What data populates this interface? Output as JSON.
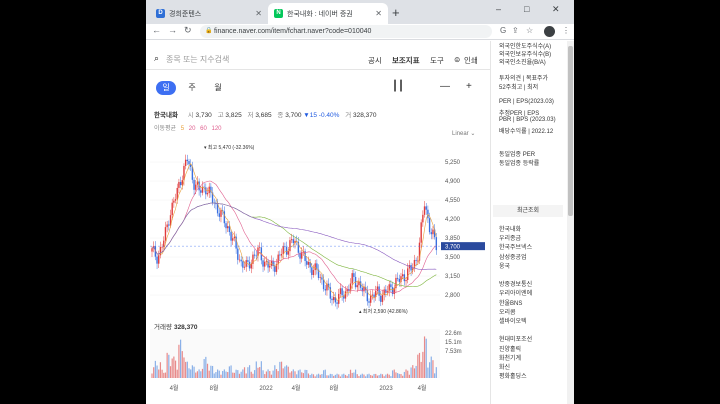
{
  "browser": {
    "tabs": [
      {
        "title": "경희준텐스",
        "favicon": "D",
        "favicon_color": "#2f6fd6"
      },
      {
        "title": "한국내화 : 네이버 증권",
        "favicon": "N",
        "favicon_color": "#03c75a"
      }
    ],
    "new_tab": "+",
    "url": "finance.naver.com/item/fchart.naver?code=010040",
    "window_controls": [
      "–",
      "□",
      "✕"
    ]
  },
  "header": {
    "search_placeholder": "종목 또는 지수검색",
    "menu": [
      "공시",
      "보조지표",
      "도구",
      "인쇄"
    ]
  },
  "periods": [
    {
      "label": "일",
      "active": true
    },
    {
      "label": "주",
      "active": false
    },
    {
      "label": "월",
      "active": false
    }
  ],
  "quote": {
    "name": "한국내화",
    "open_label": "시",
    "open": "3,730",
    "high_label": "고",
    "high": "3,825",
    "low_label": "저",
    "low": "3,685",
    "close_label": "종",
    "close": "3,700",
    "change": "▼15",
    "change_pct": "-0.40%",
    "volume_label": "거",
    "volume": "328,370"
  },
  "ma": {
    "label": "이동평균",
    "values": [
      {
        "text": "5",
        "color": "#e8a03a"
      },
      {
        "text": "20",
        "color": "#e0608f"
      },
      {
        "text": "60",
        "color": "#e0608f"
      },
      {
        "text": "120",
        "color": "#e0608f"
      }
    ]
  },
  "scale_mode": "Linear",
  "chart_data": {
    "type": "line",
    "y_ticks": [
      5250,
      4900,
      4550,
      4200,
      3850,
      3500,
      3150,
      2800
    ],
    "y_tick_labels": [
      "5,250",
      "4,900",
      "4,550",
      "4,200",
      "3,850",
      "3,500",
      "3,150",
      "2,800"
    ],
    "current_price_label": "3,700",
    "max_annotation": "최고 5,470 (-32.36%)",
    "min_annotation": "최저 2,590 (42.86%)",
    "x_tick_labels": [
      "4월",
      "8월",
      "2022",
      "4월",
      "8월",
      "2023",
      "4월"
    ],
    "volume_ticks": [
      "22.6m",
      "15.1m",
      "7.53m"
    ],
    "volume_label": "거래량",
    "volume_value": "328,370",
    "close_series": [
      3600,
      3500,
      3800,
      4300,
      4600,
      5000,
      5300,
      4900,
      4700,
      4800,
      4600,
      4400,
      4200,
      4000,
      3700,
      3400,
      3300,
      3500,
      3600,
      3400,
      3300,
      3400,
      3600,
      3700,
      3800,
      3600,
      3400,
      3300,
      3200,
      3000,
      2800,
      2700,
      2800,
      2900,
      3100,
      3000,
      2800,
      2750,
      2850,
      2800,
      2900,
      3000,
      3100,
      3200,
      3300,
      3600,
      4500,
      4000,
      3700
    ],
    "volume_series": [
      0.3,
      0.4,
      0.2,
      0.6,
      0.5,
      0.9,
      0.4,
      0.3,
      0.2,
      0.5,
      0.3,
      0.2,
      0.2,
      0.3,
      0.2,
      0.2,
      0.3,
      0.2,
      0.4,
      0.2,
      0.2,
      0.3,
      0.4,
      0.3,
      0.2,
      0.2,
      0.2,
      0.1,
      0.1,
      0.2,
      0.1,
      0.1,
      0.1,
      0.1,
      0.2,
      0.1,
      0.1,
      0.1,
      0.1,
      0.1,
      0.1,
      0.2,
      0.1,
      0.2,
      0.3,
      0.6,
      1.0,
      0.5,
      0.3
    ]
  },
  "right_panel": {
    "top_items": [
      "외국인한도주식수(A)",
      "외국인보유주식수(B)",
      "외국인소진율(B/A)"
    ],
    "invest_items": [
      "투자의견 | 목표주가",
      "52주최고 | 최저"
    ],
    "per_items": [
      "PER | EPS(2023.03)",
      "추정PER | EPS",
      "PBR | BPS (2023.03)",
      "배당수익률 | 2022.12"
    ],
    "sector_items": [
      "동일업종 PER",
      "동일업종 등락률"
    ],
    "recent_title": "최근조회",
    "recent_items": [
      "한국내화",
      "우리종금",
      "한국주브넥스",
      "삼성중공업",
      "웅국",
      "",
      "방중경보통신",
      "우리아이엔에",
      "한울BNS",
      "오리콤",
      "셀바이오텍",
      "",
      "현대미포조선",
      "진양홀릭",
      "화천기계",
      "화신",
      "평화홀딩스"
    ]
  }
}
